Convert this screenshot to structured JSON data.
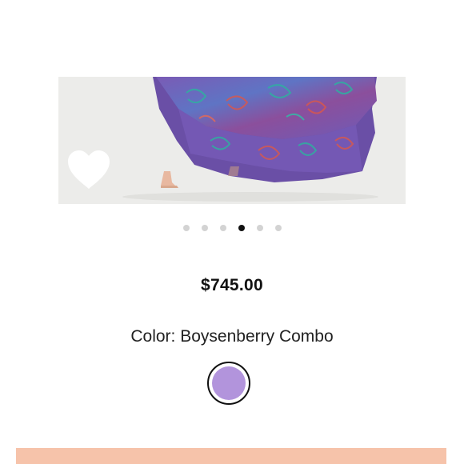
{
  "product": {
    "price": "$745.00",
    "color_label": "Color:",
    "color_name": "Boysenberry Combo"
  },
  "carousel": {
    "total_images": 6,
    "active_index": 3
  },
  "colors": {
    "swatch": "#b294dc",
    "cta": "#f6c3aa",
    "dot_active": "#111111",
    "dot_inactive": "#d3d3d3"
  },
  "icons": {
    "wishlist": "heart-icon"
  }
}
